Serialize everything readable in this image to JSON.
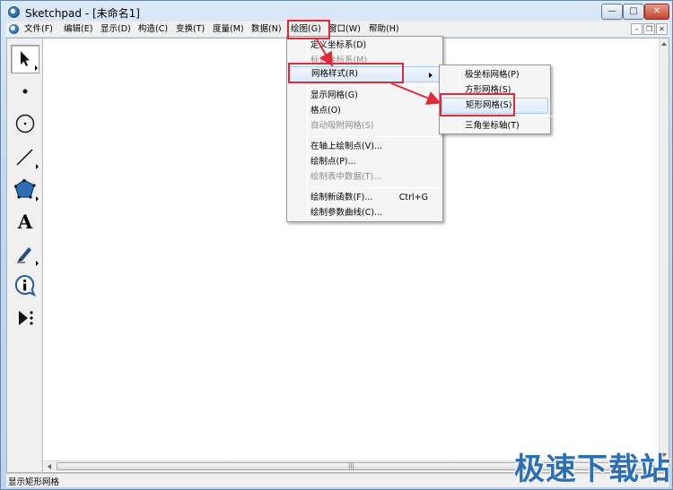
{
  "window": {
    "title": "Sketchpad  - [未命名1]",
    "minimize_glyph": "—",
    "maximize_glyph": "□",
    "close_glyph": "✕",
    "mdi_minimize_glyph": "–",
    "mdi_restore_glyph": "❐",
    "mdi_close_glyph": "✕"
  },
  "menubar": {
    "items": [
      {
        "label": "文件(F)"
      },
      {
        "label": "编辑(E)"
      },
      {
        "label": "显示(D)"
      },
      {
        "label": "构造(C)"
      },
      {
        "label": "变换(T)"
      },
      {
        "label": "度量(M)"
      },
      {
        "label": "数据(N)"
      },
      {
        "label": "绘图(G)"
      },
      {
        "label": "窗口(W)"
      },
      {
        "label": "帮助(H)"
      }
    ]
  },
  "toolbox": {
    "tools": [
      {
        "icon": "arrow-select-icon",
        "selected": true
      },
      {
        "icon": "point-icon"
      },
      {
        "icon": "compass-icon"
      },
      {
        "icon": "straightedge-icon"
      },
      {
        "icon": "polygon-icon"
      },
      {
        "icon": "text-icon",
        "glyph": "A"
      },
      {
        "icon": "marker-icon"
      },
      {
        "icon": "information-icon",
        "glyph": "i"
      },
      {
        "icon": "custom-tool-icon"
      }
    ]
  },
  "graph_menu": {
    "items": [
      {
        "label": "定义坐标系(D)",
        "disabled": false
      },
      {
        "label": "标记坐标系(M)",
        "disabled": true
      },
      {
        "label": "网格样式(R)",
        "disabled": false,
        "submenu": true,
        "highlighted": true
      },
      {
        "label": "显示网格(G)",
        "disabled": false
      },
      {
        "label": "格点(O)",
        "disabled": false
      },
      {
        "label": "自动吸附网格(S)",
        "disabled": true
      },
      {
        "label": "在轴上绘制点(V)...",
        "disabled": false
      },
      {
        "label": "绘制点(P)...",
        "disabled": false
      },
      {
        "label": "绘制表中数据(T)...",
        "disabled": true
      },
      {
        "label": "绘制新函数(F)...",
        "disabled": false,
        "shortcut": "Ctrl+G"
      },
      {
        "label": "绘制参数曲线(C)...",
        "disabled": false
      }
    ]
  },
  "grid_style_submenu": {
    "items": [
      {
        "label": "极坐标网格(P)"
      },
      {
        "label": "方形网格(S)"
      },
      {
        "label": "矩形网格(S)",
        "highlighted": true
      },
      {
        "label": "三角坐标轴(T)"
      }
    ]
  },
  "scrollbar": {
    "thumb_grip": "|||"
  },
  "statusbar": {
    "text": "显示矩形网格"
  },
  "watermark": {
    "text": "极速下载站"
  },
  "colors": {
    "annotation": "#e02a3a",
    "menu_highlight": "#dcebfc",
    "watermark": "#2c6fb5"
  }
}
